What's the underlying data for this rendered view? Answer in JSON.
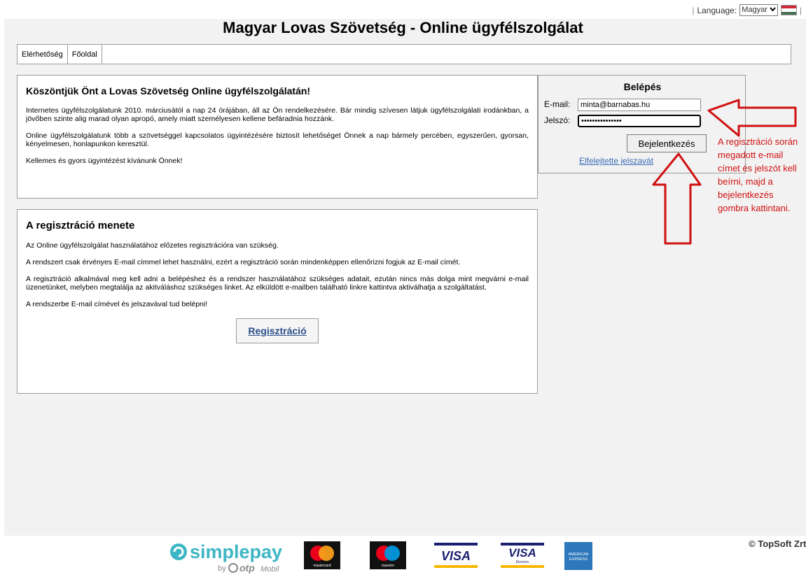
{
  "header": {
    "language_label": "Language:",
    "language_value": "Magyar",
    "title": "Magyar Lovas Szövetség - Online ügyfélszolgálat"
  },
  "nav": {
    "tabs": [
      "Elérhetőség",
      "Főoldal"
    ]
  },
  "welcome": {
    "title": "Köszöntjük Önt a Lovas Szövetség Online ügyfélszolgálatán!",
    "paragraphs": [
      "Internetes ügyfélszolgálatunk 2010. márciusától a nap 24 órájában, áll az Ön rendelkezésére. Bár mindig szívesen látjuk ügyfélszolgálati irodánkban, a jövőben szinte alig marad olyan apropó, amely miatt személyesen kellene befáradnia hozzánk.",
      "Online ügyfélszolgálatunk több a szövetséggel kapcsolatos ügyintézésére biztosít lehetőséget Önnek a nap bármely percében, egyszerűen, gyorsan, kényelmesen, honlapunkon keresztül.",
      "Kellemes és gyors ügyintézést kívánunk Önnek!"
    ]
  },
  "registration": {
    "title": "A regisztráció menete",
    "paragraphs": [
      "Az Online ügyfélszolgálat használatához előzetes regisztrációra van szükség.",
      "A rendszert csak érvényes E-mail címmel lehet használni, ezért a regisztráció során mindenképpen ellenőrizni fogjuk az E-mail címét.",
      "A regisztráció alkalmával meg kell adni a belépéshez és a rendszer használatához szükséges adatait, ezután nincs más dolga mint megvárni e-mail üzenetünket, melyben megtalálja az akitváláshoz szükséges linket. Az elküldött e-mailben található linkre kattintva aktiválhatja a szolgáltatást.",
      "A rendszerbe E-mail címével és jelszavával tud belépni!"
    ],
    "button_label": "Regisztráció"
  },
  "login": {
    "title": "Belépés",
    "email_label": "E-mail:",
    "email_value": "minta@barnabas.hu",
    "password_label": "Jelszó:",
    "password_value": "•••••••••••••••",
    "submit_label": "Bejelentkezés",
    "forgot_label": "Elfelejtette jelszavát"
  },
  "annotation": {
    "text": "A regisztráció során megadott e-mail címet és jelszót kell beírni, majd a bejelentkezés gombra kattintani.",
    "color": "#d01010"
  },
  "footer": {
    "payment_brand": "simplepay",
    "payment_sub": "by otp Mobil",
    "cards": [
      "mastercard",
      "maestro",
      "VISA",
      "VISA",
      "AMERICAN EXPRESS"
    ],
    "card_sub_visa_electron": "Electron",
    "copyright": "© TopSoft Zrt."
  },
  "colors": {
    "accent_link": "#3a6bb5",
    "register_button_text": "#2b4f8a",
    "flag": [
      "#ce2939",
      "#ffffff",
      "#477050"
    ]
  }
}
